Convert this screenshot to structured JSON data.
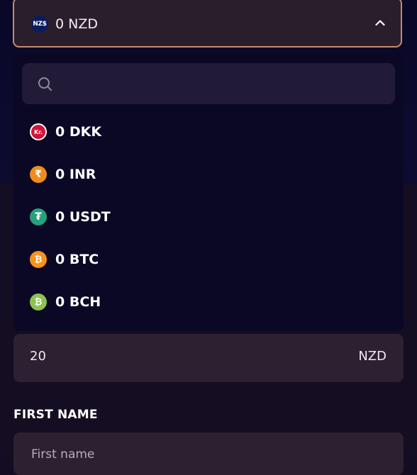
{
  "selector": {
    "logo_text": "NZ$",
    "label": "0 NZD"
  },
  "search": {
    "placeholder": ""
  },
  "options": [
    {
      "label": "0 DKK",
      "icon": "krone-icon",
      "symbol": "Kr.",
      "color": "#d2143a"
    },
    {
      "label": "0 INR",
      "icon": "rupee-icon",
      "symbol": "₹",
      "color": "#f08b1c"
    },
    {
      "label": "0 USDT",
      "icon": "tether-icon",
      "symbol": "₮",
      "color": "#26a17b"
    },
    {
      "label": "0 BTC",
      "icon": "bitcoin-icon",
      "symbol": "₿",
      "color": "#f7931a"
    },
    {
      "label": "0 BCH",
      "icon": "bitcoin-cash-icon",
      "symbol": "₿",
      "color": "#8dc351"
    }
  ],
  "amount": {
    "value": "20",
    "currency": "NZD"
  },
  "first_name": {
    "label": "FIRST NAME",
    "placeholder": "First name"
  }
}
